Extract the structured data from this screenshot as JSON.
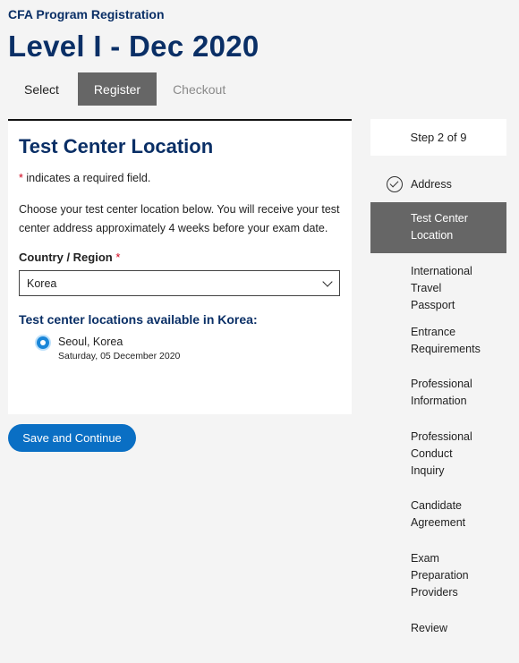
{
  "header": {
    "subtitle": "CFA Program Registration",
    "title": "Level I - Dec 2020"
  },
  "stepper": {
    "select": "Select",
    "register": "Register",
    "checkout": "Checkout"
  },
  "card": {
    "title": "Test Center Location",
    "required_star": "*",
    "required_text": " indicates a required field.",
    "intro": "Choose your test center location below. You will receive your test center address approximately 4 weeks before your exam date.",
    "country_label": "Country / Region",
    "country_star": "*",
    "country_value": "Korea",
    "available_heading": "Test center locations available in Korea:",
    "location_name": "Seoul, Korea",
    "location_date": "Saturday, 05 December 2020"
  },
  "save_button": "Save and Continue",
  "sidebar": {
    "step_label": "Step 2 of 9",
    "items": [
      {
        "label": "Address",
        "state": "done"
      },
      {
        "label": "Test Center Location",
        "state": "active"
      },
      {
        "label": "International Travel Passport",
        "state": "pending"
      },
      {
        "label": "Entrance Requirements",
        "state": "pending"
      },
      {
        "label": "Professional Information",
        "state": "pending"
      },
      {
        "label": "Professional Conduct Inquiry",
        "state": "pending"
      },
      {
        "label": "Candidate Agreement",
        "state": "pending"
      },
      {
        "label": "Exam Preparation Providers",
        "state": "pending"
      },
      {
        "label": "Review",
        "state": "pending"
      }
    ]
  },
  "colors": {
    "brand_navy": "#0a2f66",
    "button_blue": "#0a6fc4",
    "active_gray": "#666666",
    "required_red": "#d0021b"
  }
}
